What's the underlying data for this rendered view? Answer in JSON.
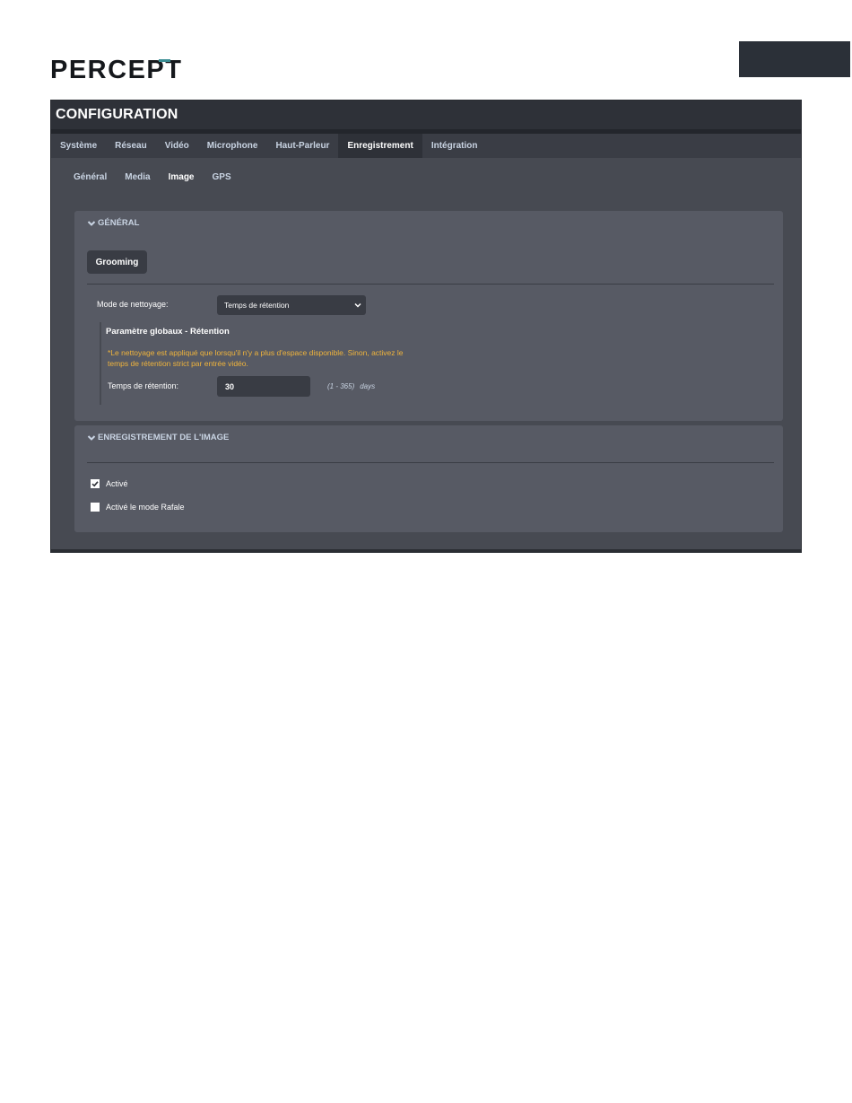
{
  "brand": {
    "logo_text": "PERCEPT"
  },
  "app": {
    "title": "CONFIGURATION"
  },
  "tabs": [
    {
      "label": "Système"
    },
    {
      "label": "Réseau"
    },
    {
      "label": "Vidéo"
    },
    {
      "label": "Microphone"
    },
    {
      "label": "Haut-Parleur"
    },
    {
      "label": "Enregistrement",
      "active": true
    },
    {
      "label": "Intégration"
    }
  ],
  "subtabs": [
    {
      "label": "Général"
    },
    {
      "label": "Media"
    },
    {
      "label": "Image",
      "active": true
    },
    {
      "label": "GPS"
    }
  ],
  "general": {
    "header": "GÉNÉRAL",
    "grooming_button": "Grooming",
    "cleanup_mode_label": "Mode de nettoyage:",
    "cleanup_mode_value": "Temps de rétention",
    "global_params": {
      "title": "Paramètre globaux - Rétention",
      "note_line1": "*Le nettoyage est appliqué que lorsqu'il n'y a plus d'espace disponible. Sinon, activez le",
      "note_line2": "temps de rétention strict par entrée vidéo.",
      "retention_label": "Temps de rétention:",
      "retention_value": "30",
      "range_hint": "(1 - 365)",
      "units": "days"
    }
  },
  "image_recording": {
    "header": "ENREGISTREMENT DE L'IMAGE",
    "enabled_label": "Activé",
    "enabled_checked": true,
    "burst_label": "Activé le mode Rafale",
    "burst_checked": false
  },
  "colors": {
    "accent_teal": "#3a8d93",
    "warning_text": "#f0b43c"
  }
}
